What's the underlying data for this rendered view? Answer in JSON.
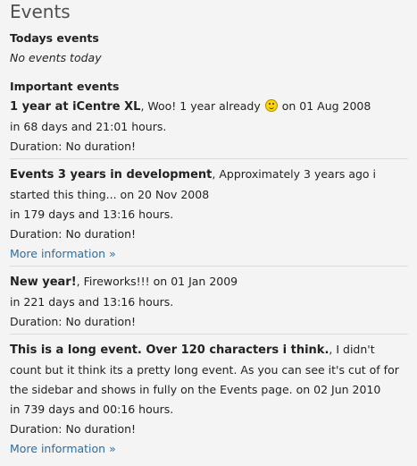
{
  "page": {
    "title": "Events"
  },
  "todays": {
    "heading": "Todays events",
    "empty_text": "No events today"
  },
  "important": {
    "heading": "Important events",
    "events": [
      {
        "name": "1 year at iCentre XL",
        "description_before": ", Woo! 1 year already",
        "description_after": " on 01 Aug 2008",
        "countdown": "in 68 days and 21:01 hours.",
        "duration": "Duration: No duration!",
        "more_link": ""
      },
      {
        "name": "Events 3 years in development",
        "description_before": ", Approximately 3 years ago i started this thing... on 20 Nov 2008",
        "description_after": "",
        "countdown": "in 179 days and 13:16 hours.",
        "duration": "Duration: No duration!",
        "more_link": "More information »"
      },
      {
        "name": "New year!",
        "description_before": ", Fireworks!!! on 01 Jan 2009",
        "description_after": "",
        "countdown": "in 221 days and 13:16 hours.",
        "duration": "Duration: No duration!",
        "more_link": ""
      },
      {
        "name": "This is a long event. Over 120 characters i think.",
        "description_before": ", I didn't count but it think its a pretty long event. As you can see it's cut of for the sidebar and shows in fully on the Events page. on 02 Jun 2010",
        "description_after": "",
        "countdown": "in 739 days and 00:16 hours.",
        "duration": "Duration: No duration!",
        "more_link": "More information »"
      }
    ]
  },
  "icons": {
    "smiley": "smiley-icon"
  },
  "colors": {
    "link": "#2a6ea6",
    "smiley": "#ffd700"
  }
}
